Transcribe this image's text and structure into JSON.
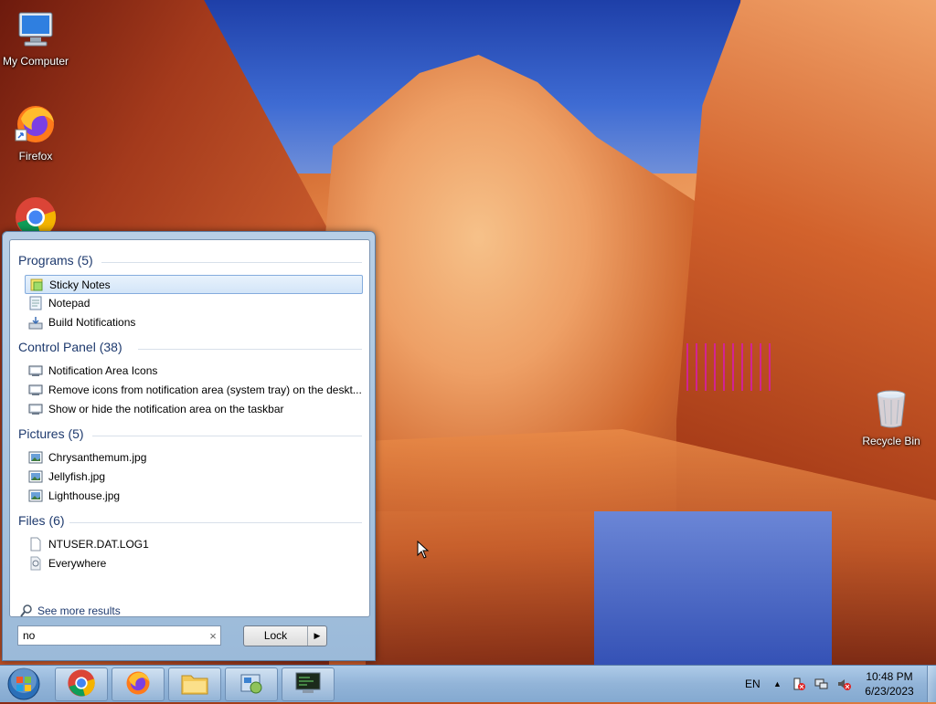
{
  "desktop": {
    "icons": [
      {
        "label": "My Computer",
        "icon": "computer-icon"
      },
      {
        "label": "Firefox",
        "icon": "firefox-icon"
      },
      {
        "label": "",
        "icon": "chrome-icon"
      },
      {
        "label": "Recycle Bin",
        "icon": "recycle-bin-icon"
      }
    ]
  },
  "start_menu": {
    "groups": [
      {
        "title": "Programs (5)",
        "items": [
          {
            "label": "Sticky Notes",
            "icon": "sticky-notes-icon",
            "selected": true
          },
          {
            "label": "Notepad",
            "icon": "notepad-icon"
          },
          {
            "label": "Build Notifications",
            "icon": "build-notifications-icon"
          }
        ]
      },
      {
        "title": "Control Panel (38)",
        "items": [
          {
            "label": "Notification Area Icons",
            "icon": "control-panel-icon"
          },
          {
            "label": "Remove icons from notification area (system tray) on the deskt...",
            "icon": "control-panel-icon"
          },
          {
            "label": "Show or hide the notification area on the taskbar",
            "icon": "control-panel-icon"
          }
        ]
      },
      {
        "title": "Pictures (5)",
        "items": [
          {
            "label": "Chrysanthemum.jpg",
            "icon": "image-file-icon"
          },
          {
            "label": "Jellyfish.jpg",
            "icon": "image-file-icon"
          },
          {
            "label": "Lighthouse.jpg",
            "icon": "image-file-icon"
          }
        ]
      },
      {
        "title": "Files (6)",
        "items": [
          {
            "label": "NTUSER.DAT.LOG1",
            "icon": "file-icon"
          },
          {
            "label": "Everywhere",
            "icon": "search-everywhere-icon"
          }
        ]
      }
    ],
    "see_more": "See more results",
    "search_value": "no",
    "clear_glyph": "×",
    "lock_label": "Lock",
    "lock_arrow": "▶"
  },
  "taskbar": {
    "pinned": [
      "chrome-icon",
      "firefox-icon",
      "file-explorer-icon",
      "control-panel-icon",
      "terminal-icon"
    ],
    "language": "EN",
    "tray_arrow": "▲",
    "time": "10:48 PM",
    "date": "6/23/2023"
  },
  "colors": {
    "group_title": "#1e3a6e",
    "selection_border": "#84acdd"
  }
}
